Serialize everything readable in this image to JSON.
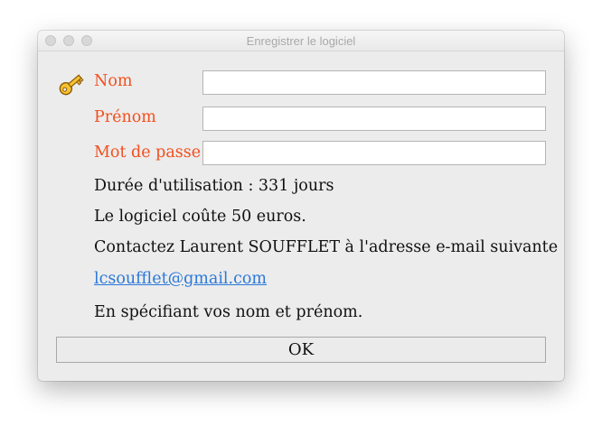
{
  "window": {
    "title": "Enregistrer le logiciel"
  },
  "form": {
    "icon": "key-icon",
    "name_label": "Nom",
    "name_value": "",
    "firstname_label": "Prénom",
    "firstname_value": "",
    "password_label": "Mot de passe",
    "password_value": ""
  },
  "info": {
    "duration": "Durée d'utilisation : 331 jours",
    "price": "Le logiciel coûte 50 euros.",
    "contact": "Contactez Laurent SOUFFLET à l'adresse e-mail suivante :",
    "email": "lcsoufflet@gmail.com",
    "specify": "En spécifiant vos nom et prénom."
  },
  "buttons": {
    "ok_label": "OK"
  },
  "colors": {
    "label_color": "#f2501e",
    "link_color": "#2b78d8"
  }
}
